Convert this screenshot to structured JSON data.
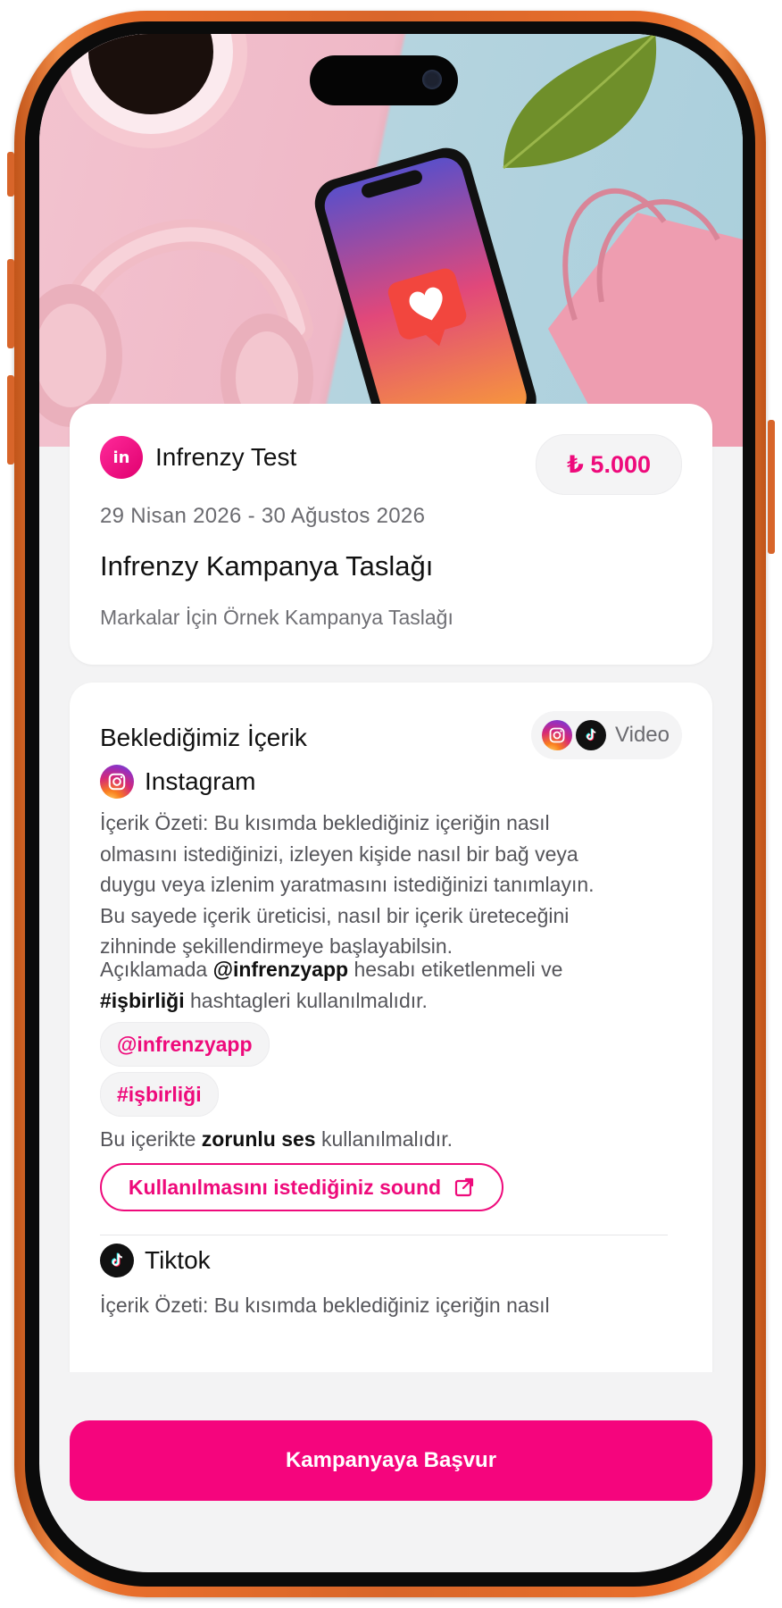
{
  "brand": {
    "name": "Infrenzy Test",
    "logo_text": "in"
  },
  "campaign": {
    "price": "₺ 5.000",
    "dates": "29 Nisan 2026 - 30 Ağustos 2026",
    "title": "Infrenzy Kampanya Taslağı",
    "subtitle": "Markalar İçin Örnek Kampanya Taslağı"
  },
  "content_section": {
    "heading": "Beklediğimiz İçerik",
    "format_label": "Video",
    "platform_icons": [
      "instagram-icon",
      "tiktok-icon"
    ]
  },
  "instagram": {
    "platform_name": "Instagram",
    "summary": "İçerik Özeti: Bu kısımda beklediğiniz içeriğin nasıl olmasını istediğinizi, izleyen kişide nasıl bir bağ veya duygu veya izlenim yaratmasını istediğinizi tanımlayın. Bu sayede içerik üreticisi, nasıl bir içerik üreteceğini zihninde şekillendirmeye başlayabilsin.",
    "caption_prefix": "Açıklamada",
    "mention": "@infrenzyapp",
    "caption_middle": "hesabı etiketlenmeli ve",
    "hashtag": "#işbirliği",
    "caption_suffix": "hashtagleri kullanılmalıdır.",
    "tags": [
      "@infrenzyapp",
      "#işbirliği"
    ],
    "sound_prefix": "Bu içerikte",
    "sound_bold": "zorunlu ses",
    "sound_suffix": "kullanılmalıdır.",
    "sound_button": "Kullanılmasını istediğiniz sound"
  },
  "tiktok": {
    "platform_name": "Tiktok",
    "summary": "İçerik Özeti: Bu kısımda beklediğiniz içeriğin nasıl"
  },
  "cta": {
    "label": "Kampanyaya Başvur"
  },
  "colors": {
    "accent": "#F5057D",
    "frame": "#E86F2C",
    "background": "#F3F3F4"
  }
}
